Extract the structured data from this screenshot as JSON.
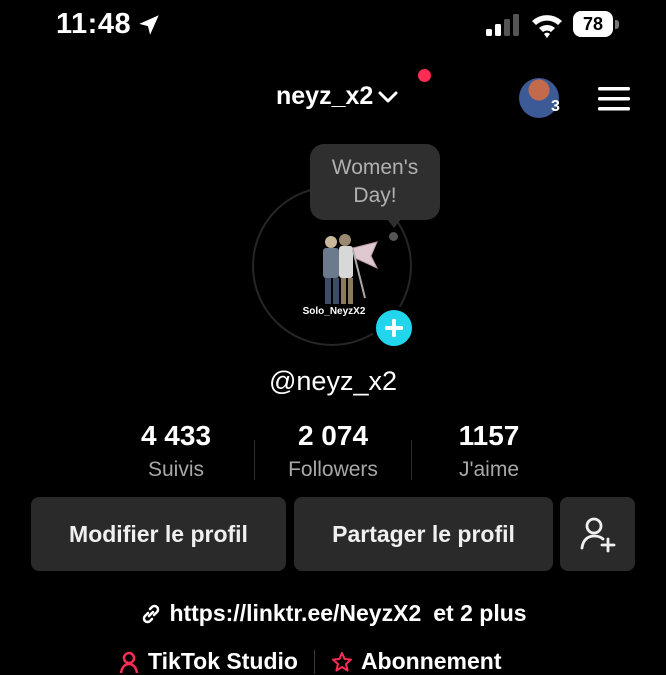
{
  "status_bar": {
    "time": "11:48",
    "battery": "78"
  },
  "header": {
    "username": "neyz_x2",
    "avatar_count": "3"
  },
  "profile": {
    "tooltip": "Women's Day!",
    "photo_caption": "Solo_NeyzX2",
    "handle": "@neyz_x2"
  },
  "stats": [
    {
      "value": "4 433",
      "label": "Suivis"
    },
    {
      "value": "2 074",
      "label": "Followers"
    },
    {
      "value": "1157",
      "label": "J'aime"
    }
  ],
  "buttons": {
    "edit": "Modifier le profil",
    "share": "Partager le profil"
  },
  "link": {
    "url": "https://linktr.ee/NeyzX2",
    "more": "et 2 plus"
  },
  "bottom": {
    "studio": "TikTok Studio",
    "subscription": "Abonnement"
  },
  "colors": {
    "accent_red": "#fe2c55",
    "accent_cyan": "#20d5ec",
    "button_bg": "#2a2a2a"
  }
}
